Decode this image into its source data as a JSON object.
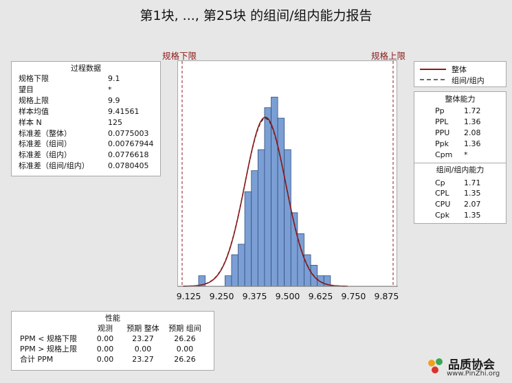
{
  "title": "第1块, ..., 第25块 的组间/组内能力报告",
  "limit_labels": {
    "lsl": "规格下限",
    "usl": "规格上限"
  },
  "process_data": {
    "header": "过程数据",
    "rows": [
      {
        "label": "规格下限",
        "value": "9.1"
      },
      {
        "label": "望目",
        "value": "*"
      },
      {
        "label": "规格上限",
        "value": "9.9"
      },
      {
        "label": "样本均值",
        "value": "9.41561"
      },
      {
        "label": "样本 N",
        "value": "125"
      },
      {
        "label": "标准差（整体）",
        "value": "0.0775003"
      },
      {
        "label": "标准差（组间）",
        "value": "0.00767944"
      },
      {
        "label": "标准差（组内）",
        "value": "0.0776618"
      },
      {
        "label": "标准差（组间/组内）",
        "value": "0.0780405"
      }
    ]
  },
  "legend": {
    "overall": "整体",
    "between_within": "组间/组内"
  },
  "overall_capability": {
    "header": "整体能力",
    "rows": [
      {
        "label": "Pp",
        "value": "1.72"
      },
      {
        "label": "PPL",
        "value": "1.36"
      },
      {
        "label": "PPU",
        "value": "2.08"
      },
      {
        "label": "Ppk",
        "value": "1.36"
      },
      {
        "label": "Cpm",
        "value": "*"
      }
    ]
  },
  "bw_capability": {
    "header": "组间/组内能力",
    "rows": [
      {
        "label": "Cp",
        "value": "1.71"
      },
      {
        "label": "CPL",
        "value": "1.35"
      },
      {
        "label": "CPU",
        "value": "2.07"
      },
      {
        "label": "Cpk",
        "value": "1.35"
      }
    ]
  },
  "performance": {
    "header": "性能",
    "columns": [
      "",
      "观测",
      "预期 整体",
      "预期 组间"
    ],
    "rows": [
      [
        "PPM < 规格下限",
        "0.00",
        "23.27",
        "26.26"
      ],
      [
        "PPM > 规格上限",
        "0.00",
        "0.00",
        "0.00"
      ],
      [
        "合计 PPM",
        "0.00",
        "23.27",
        "26.26"
      ]
    ]
  },
  "logo": {
    "name": "品质协会",
    "url": "www.PinZhi.org"
  },
  "colors": {
    "bar": "#7b9fd4",
    "bar_edge": "#2f4f7f",
    "overall_line": "#8b1a1a",
    "within_line": "#333333",
    "limit": "#8b1a1a"
  },
  "chart_data": {
    "type": "bar",
    "subtype": "histogram-with-normal-fits",
    "bin_width": 0.025,
    "bin_start": 9.1375,
    "counts": [
      0,
      1,
      0,
      0,
      0,
      1,
      3,
      4,
      9,
      11,
      13,
      17,
      18,
      16,
      13,
      7,
      5,
      3,
      2,
      1,
      1,
      0
    ],
    "xlim": [
      9.1,
      9.9
    ],
    "xticks": [
      "9.125",
      "9.250",
      "9.375",
      "9.500",
      "9.625",
      "9.750",
      "9.875"
    ],
    "xtick_values": [
      9.125,
      9.25,
      9.375,
      9.5,
      9.625,
      9.75,
      9.875
    ],
    "lsl": 9.1,
    "usl": 9.9,
    "mean": 9.41561,
    "sd_overall": 0.0775003,
    "sd_between_within": 0.0780405
  }
}
